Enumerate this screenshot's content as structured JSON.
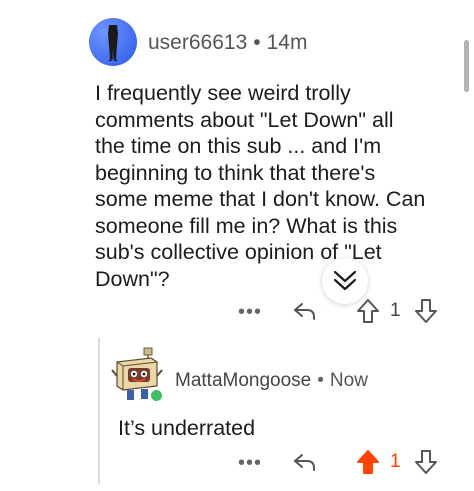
{
  "comment": {
    "username": "user66613",
    "separator": "•",
    "timestamp": "14m",
    "body_lines": [
      "I frequently see weird trolly",
      "comments about \"Let Down\" all",
      "the time on this sub ... and I'm",
      "beginning to think that there's",
      "some meme that I don't know. Can",
      "someone fill me in? What is this",
      "sub's collective opinion of \"Let",
      "Down\"?"
    ],
    "more_label": "•••",
    "score": "1",
    "vote_state": "none"
  },
  "reply": {
    "username": "MattaMongoose",
    "separator": "•",
    "timestamp": "Now",
    "body": "It’s underrated",
    "more_label": "•••",
    "score": "1",
    "vote_state": "upvoted"
  },
  "icons": {
    "collapse": "double-chevron-down-icon",
    "reply": "reply-arrow-icon",
    "upvote": "upvote-arrow-icon",
    "downvote": "downvote-arrow-icon",
    "more": "more-options-icon"
  },
  "colors": {
    "upvote_active": "#ff4500",
    "online_indicator": "#3fbf63",
    "avatar1_bg": "#2b58e6"
  }
}
